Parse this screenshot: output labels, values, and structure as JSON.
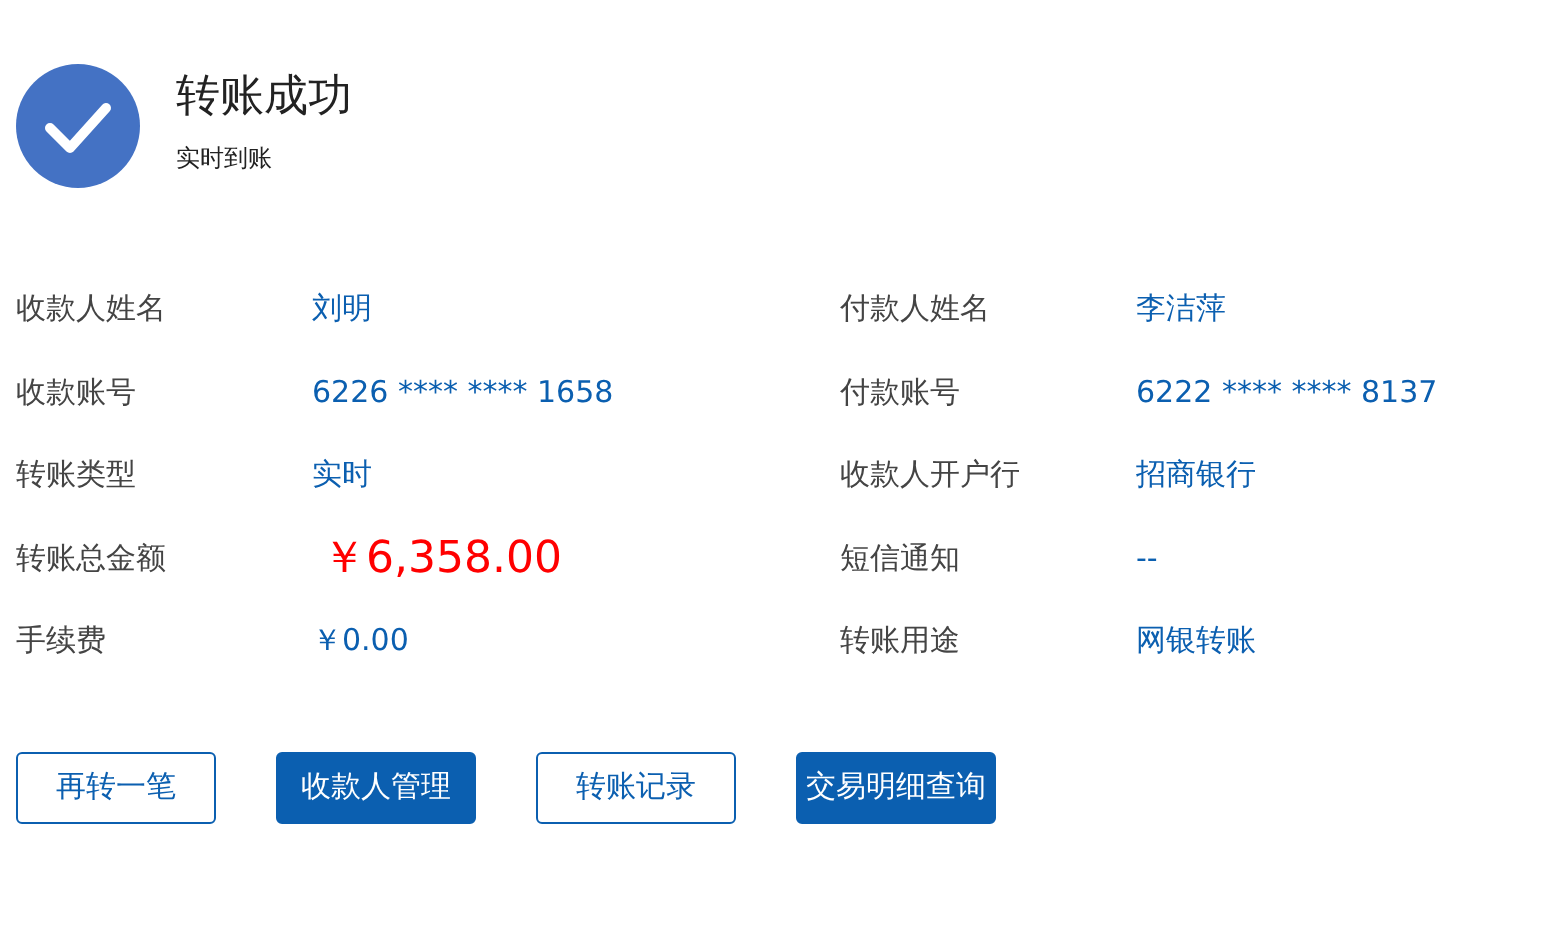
{
  "header": {
    "title": "转账成功",
    "subtitle": "实时到账"
  },
  "fields": [
    {
      "label": "收款人姓名",
      "value": "刘明",
      "kind": "text"
    },
    {
      "label": "付款人姓名",
      "value": "李洁萍",
      "kind": "text"
    },
    {
      "label": "收款账号",
      "value": "6226 **** **** 1658",
      "kind": "text"
    },
    {
      "label": "付款账号",
      "value": "6222 **** **** 8137",
      "kind": "text"
    },
    {
      "label": "转账类型",
      "value": "实时",
      "kind": "text"
    },
    {
      "label": "收款人开户行",
      "value": "招商银行",
      "kind": "text"
    },
    {
      "label": "转账总金额",
      "value": "￥6,358.00",
      "kind": "amount"
    },
    {
      "label": "短信通知",
      "value": "--",
      "kind": "text"
    },
    {
      "label": "手续费",
      "value": "￥0.00",
      "kind": "text"
    },
    {
      "label": "转账用途",
      "value": "网银转账",
      "kind": "text"
    }
  ],
  "buttons": [
    {
      "label": "再转一笔",
      "kind": "outline"
    },
    {
      "label": "收款人管理",
      "kind": "filled"
    },
    {
      "label": "转账记录",
      "kind": "outline"
    },
    {
      "label": "交易明细查询",
      "kind": "filled"
    }
  ]
}
